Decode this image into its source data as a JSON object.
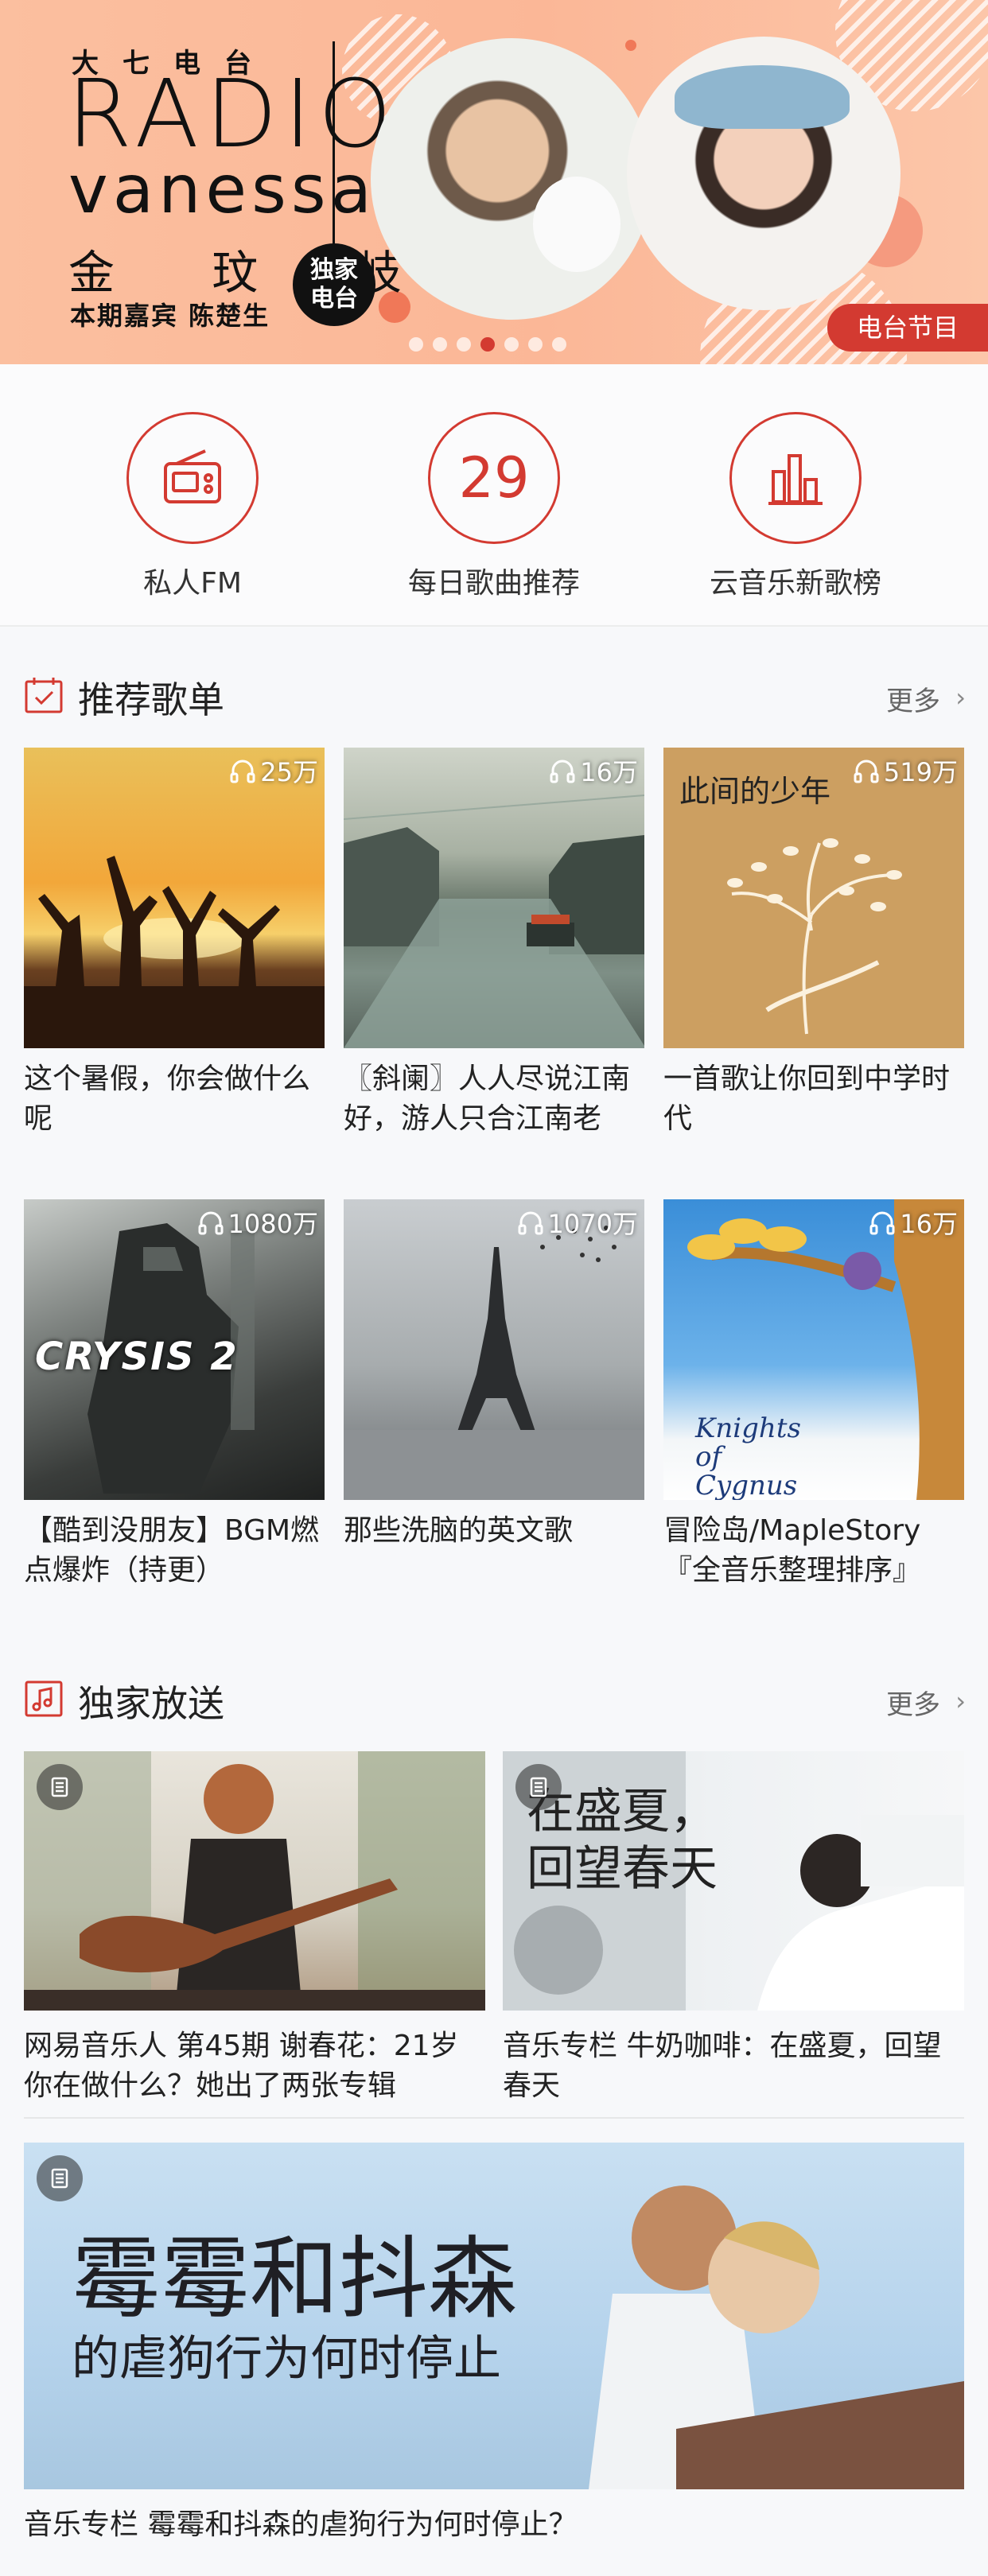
{
  "banner": {
    "top_text": "大七电台",
    "radio_text": "RADIO",
    "vanessa_text": "vanessa",
    "host_name": "金 玟 岐",
    "guest_text": "本期嘉宾 陈楚生",
    "exclusive_line1": "独家",
    "exclusive_line2": "电台",
    "tag": "电台节目",
    "pages": 7,
    "active_page": 3
  },
  "quick": [
    {
      "label": "私人FM",
      "icon": "radio-icon"
    },
    {
      "label": "每日歌曲推荐",
      "number": "29",
      "icon": "calendar-number"
    },
    {
      "label": "云音乐新歌榜",
      "icon": "chart-bars-icon"
    }
  ],
  "recommend": {
    "title": "推荐歌单",
    "more": "更多",
    "items": [
      {
        "count": "25万",
        "title": "这个暑假，你会做什么呢"
      },
      {
        "count": "16万",
        "title": "〖斜阑〗人人尽说江南好，游人只合江南老"
      },
      {
        "count": "519万",
        "title": "一首歌让你回到中学时代",
        "cover_text": "此间的少年"
      },
      {
        "count": "1080万",
        "title": "【酷到没朋友】BGM燃点爆炸（持更）",
        "cover_text": "CRYSIS 2"
      },
      {
        "count": "1070万",
        "title": "那些洗脑的英文歌"
      },
      {
        "count": "16万",
        "title": "冒险岛/MapleStory『全音乐整理排序』",
        "cover_text": "Knights of Cygnus"
      }
    ]
  },
  "exclusive": {
    "title": "独家放送",
    "more": "更多",
    "items": [
      {
        "title": "网易音乐人 第45期 谢春花：21岁你在做什么？她出了两张专辑"
      },
      {
        "title": "音乐专栏 牛奶咖啡：在盛夏，回望春天",
        "cover_line1": "在盛夏，",
        "cover_line2": "回望春天"
      },
      {
        "title": "音乐专栏 霉霉和抖森的虐狗行为何时停止？",
        "cover_line1": "霉霉和抖森",
        "cover_line2": "的虐狗行为何时停止"
      }
    ]
  },
  "colors": {
    "accent": "#d33a31",
    "banner_bg": "#fbbf9f"
  }
}
